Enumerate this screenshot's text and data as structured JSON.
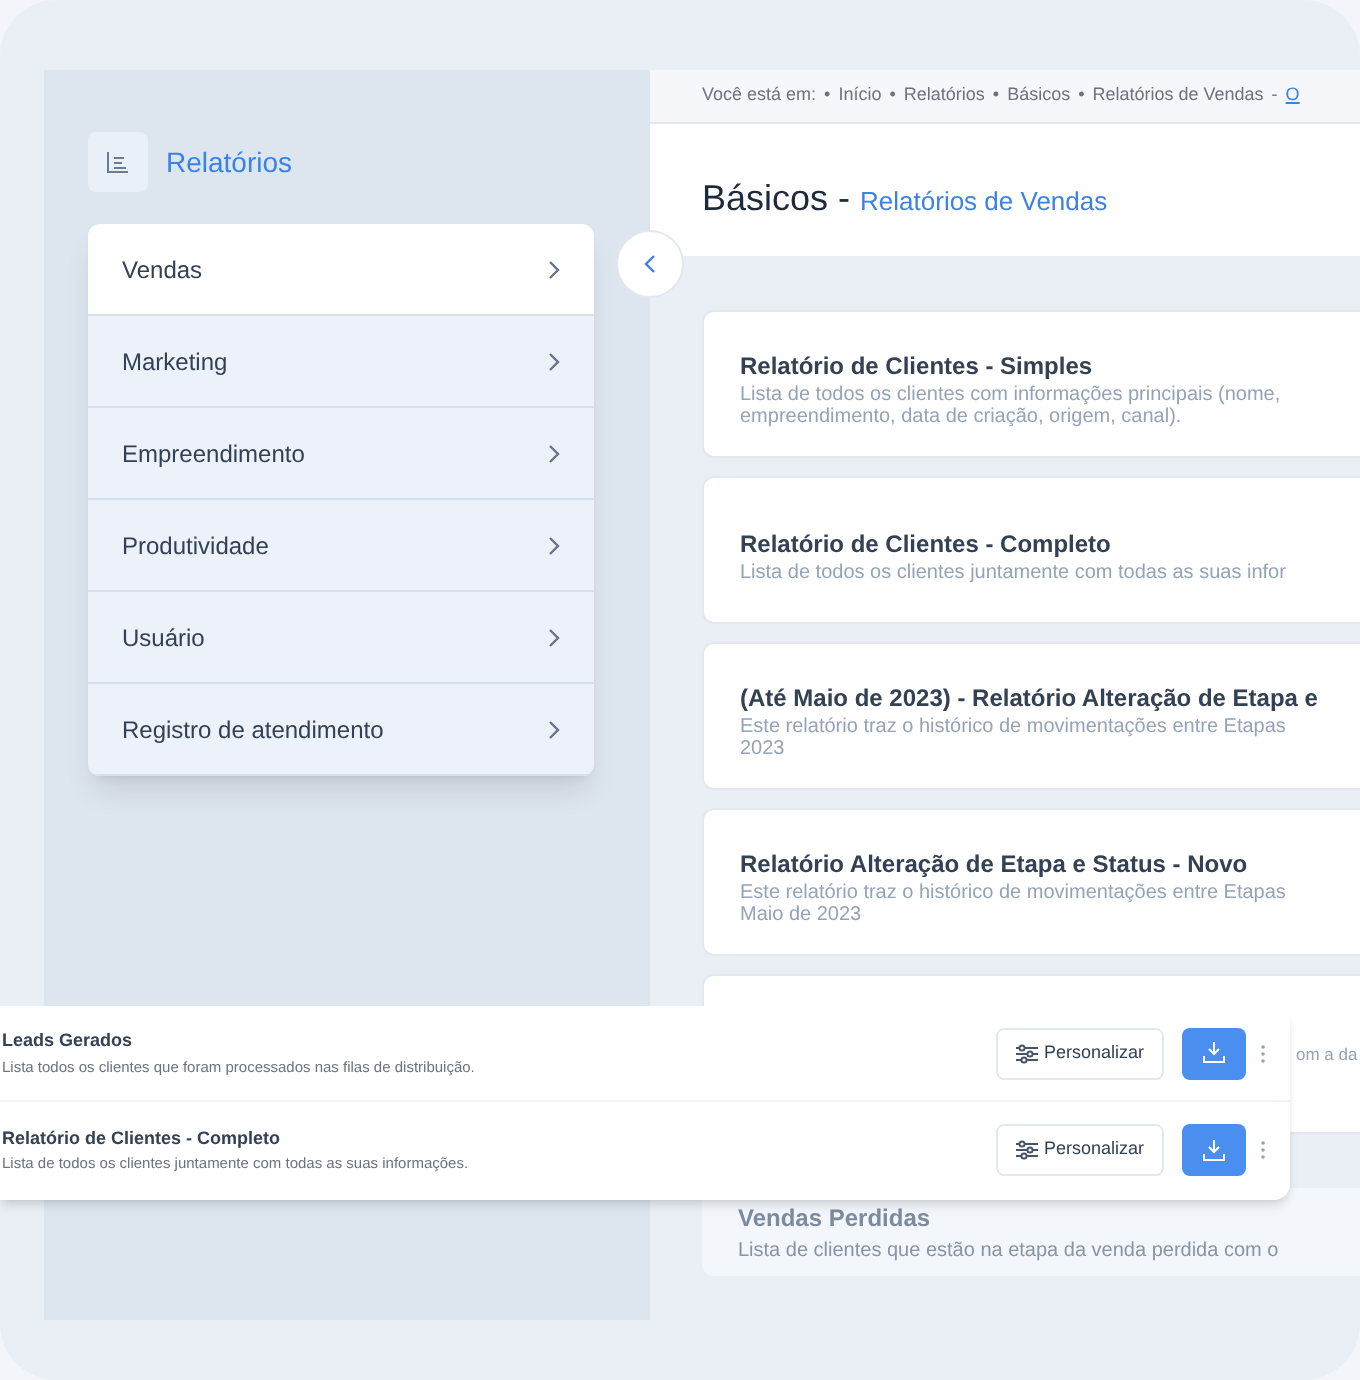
{
  "sidebar": {
    "title": "Relatórios",
    "items": [
      {
        "label": "Vendas",
        "selected": true
      },
      {
        "label": "Marketing",
        "selected": false
      },
      {
        "label": "Empreendimento",
        "selected": false
      },
      {
        "label": "Produtividade",
        "selected": false
      },
      {
        "label": "Usuário",
        "selected": false
      },
      {
        "label": "Registro de atendimento",
        "selected": false
      }
    ]
  },
  "breadcrumb": [
    {
      "kind": "label",
      "text": "Você está em:"
    },
    {
      "kind": "sep",
      "text": "•"
    },
    {
      "kind": "crumb",
      "text": "Início"
    },
    {
      "kind": "sep",
      "text": "•"
    },
    {
      "kind": "crumb",
      "text": "Relatórios"
    },
    {
      "kind": "sep",
      "text": "•"
    },
    {
      "kind": "crumb",
      "text": "Básicos"
    },
    {
      "kind": "sep",
      "text": "•"
    },
    {
      "kind": "crumb",
      "text": "Relatórios de Vendas"
    },
    {
      "kind": "sep",
      "text": "-"
    },
    {
      "kind": "link",
      "text": "O"
    }
  ],
  "header": {
    "title": "Básicos -",
    "subtitle": "Relatórios de Vendas"
  },
  "cards": [
    {
      "title": "Relatório de Clientes - Simples",
      "description": "Lista de todos os clientes com informações principais (nome,\nempreendimento, data de criação, origem, canal)."
    },
    {
      "title": "Relatório de Clientes - Completo",
      "description": "Lista de todos os clientes juntamente com todas as suas infor"
    },
    {
      "title": "(Até Maio de 2023) - Relatório Alteração de Etapa e",
      "description": "Este relatório traz o histórico de movimentações entre Etapas\n2023"
    },
    {
      "title": "Relatório Alteração de Etapa e Status - Novo",
      "description": "Este relatório traz o histórico de movimentações entre Etapas\nMaio de 2023"
    }
  ],
  "hidden_card": {
    "description": "om a da"
  },
  "faded_card": {
    "title": "Vendas Perdidas",
    "description": "Lista de clientes que estão na etapa da venda perdida com o"
  },
  "popup_rows": [
    {
      "title": "Leads Gerados",
      "description": "Lista todos os clientes que foram processados nas filas de distribuição.",
      "button": "Personalizar"
    },
    {
      "title": "Relatório de Clientes - Completo",
      "description": "Lista de todos os clientes juntamente com todas as suas informações.",
      "button": "Personalizar"
    }
  ]
}
